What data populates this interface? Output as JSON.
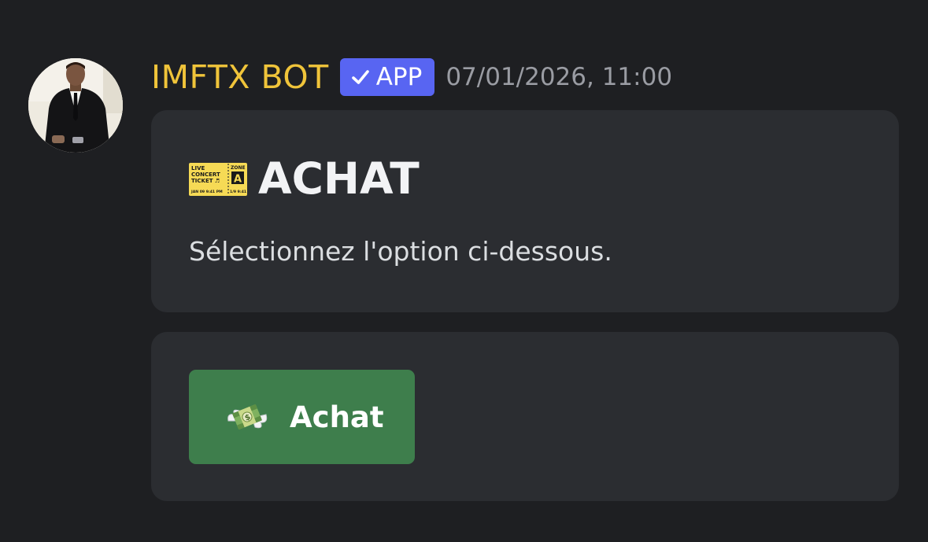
{
  "message": {
    "author": "IMFTX BOT",
    "badge": "APP",
    "badge_icon": "check-icon",
    "timestamp": "07/01/2026, 11:00",
    "avatar": "bot-avatar"
  },
  "embed": {
    "title": "ACHAT",
    "title_icon": "ticket-icon",
    "ticket_text": {
      "line1": "LIVE",
      "line2": "CONCERT",
      "line3": "TICKET ♬",
      "zone": "ZONE",
      "zone_letter": "A",
      "date": "JAN 09  9:41 PM",
      "stub_date": "1/9  9:41"
    },
    "description": "Sélectionnez l'option ci-dessous."
  },
  "actions": {
    "buttons": [
      {
        "label": "Achat",
        "icon": "money-with-wings-icon"
      }
    ]
  },
  "colors": {
    "background": "#1e1f22",
    "card": "#2b2d31",
    "author": "#f0c43a",
    "badge": "#5865f2",
    "button": "#3e7e4c"
  }
}
